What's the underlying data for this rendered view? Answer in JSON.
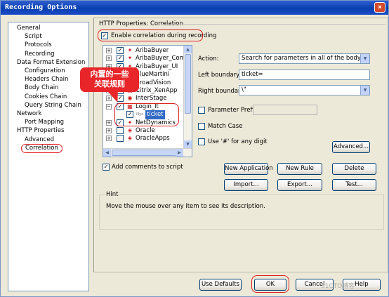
{
  "window": {
    "title": "Recording Options",
    "close_glyph": "×"
  },
  "sidebar": {
    "items": [
      {
        "label": "General",
        "level": 0
      },
      {
        "label": "Script",
        "level": 1
      },
      {
        "label": "Protocols",
        "level": 1
      },
      {
        "label": "Recording",
        "level": 1
      },
      {
        "label": "Data Format Extension",
        "level": 0
      },
      {
        "label": "Configuration",
        "level": 1
      },
      {
        "label": "Headers Chain",
        "level": 1
      },
      {
        "label": "Body Chain",
        "level": 1
      },
      {
        "label": "Cookies Chain",
        "level": 1
      },
      {
        "label": "Query String Chain",
        "level": 1
      },
      {
        "label": "Network",
        "level": 0
      },
      {
        "label": "Port Mapping",
        "level": 1
      },
      {
        "label": "HTTP Properties",
        "level": 0
      },
      {
        "label": "Advanced",
        "level": 1
      },
      {
        "label": "Correlation",
        "level": 1,
        "selected": true
      }
    ]
  },
  "panel": {
    "title": "HTTP Properties: Correlation",
    "enable_correlation_label": "Enable correlation during recording",
    "enable_correlation_checked": true,
    "add_comments_label": "Add comments to script",
    "add_comments_checked": true
  },
  "rules_list": {
    "items": [
      {
        "name": "AribaBuyer",
        "checked": true,
        "expander": "+"
      },
      {
        "name": "AribaBuyer_Comm",
        "checked": true,
        "expander": "+"
      },
      {
        "name": "AribaBuyer_UI",
        "checked": true,
        "expander": "+"
      },
      {
        "name": "BlueMartini",
        "checked": true,
        "expander": "+"
      },
      {
        "name": "BroadVision",
        "checked": true,
        "expander": "+"
      },
      {
        "name": "Citrix_XenApp",
        "checked": true,
        "expander": "+"
      },
      {
        "name": "InterStage",
        "checked": true,
        "expander": "+"
      },
      {
        "name": "Login_lt",
        "checked": true,
        "expander": "−"
      },
      {
        "name": "ticket",
        "checked": true,
        "expander": "",
        "child": true,
        "selected": true
      },
      {
        "name": "NetDynamics",
        "checked": true,
        "expander": "+"
      },
      {
        "name": "Oracle",
        "checked": false,
        "expander": "+"
      },
      {
        "name": "OracleApps",
        "checked": false,
        "expander": "+"
      }
    ],
    "child_prefix": "lllyz"
  },
  "callout": {
    "line1": "内置的一些",
    "line2": "关联规则"
  },
  "form": {
    "action_label": "Action:",
    "action_value": "Search for parameters in all of the body text",
    "left_boundary_label": "Left boundary:",
    "left_boundary_value": "ticket=",
    "right_boundary_label": "Right boundary:",
    "right_boundary_value": "\\\"",
    "parameter_prefix_label": "Parameter Prefix:",
    "parameter_prefix_value": "",
    "match_case_label": "Match Case",
    "use_hash_label": "Use '#' for any digit",
    "advanced_button": "Advanced..."
  },
  "actions": {
    "new_application": "New Application",
    "new_rule": "New Rule",
    "delete": "Delete",
    "import": "Import...",
    "export": "Export...",
    "test": "Test..."
  },
  "hint": {
    "title": "Hint",
    "text": "Move the mouse over any item to see its description."
  },
  "footer": {
    "use_defaults": "Use Defaults",
    "ok": "OK",
    "cancel": "Cancel",
    "help": "Help"
  },
  "watermark": "51CTO博客",
  "colors": {
    "accent": "#316ac5",
    "annotation": "#e02020",
    "titlebar": "#0a3fb0"
  }
}
